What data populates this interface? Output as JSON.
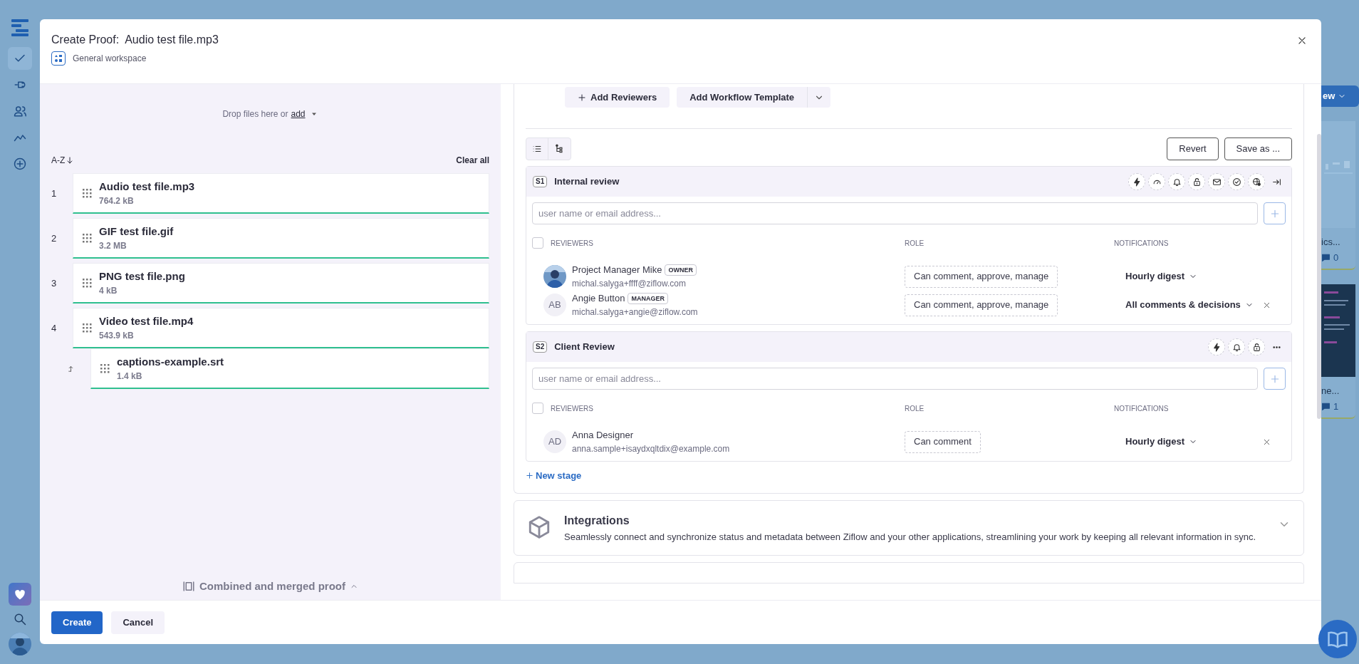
{
  "nav": {
    "items": [
      {
        "selected": true
      },
      {
        "selected": false
      },
      {
        "selected": false
      },
      {
        "selected": false
      },
      {
        "selected": false
      }
    ]
  },
  "background_app": {
    "button": "ew",
    "cards": [
      {
        "title": "ics...",
        "count": "0"
      },
      {
        "title": "ne...",
        "count": "1"
      }
    ]
  },
  "dialog": {
    "title": "Create Proof:  Audio test file.mp3",
    "workspace": "General workspace"
  },
  "upload": {
    "prompt": "Drop files here or",
    "link": "add"
  },
  "sort": {
    "label": "A-Z",
    "clear": "Clear all"
  },
  "files": [
    {
      "number": "1",
      "name": "Audio test file.mp3",
      "size": "764.2 kB"
    },
    {
      "number": "2",
      "name": "GIF test file.gif",
      "size": "3.2 MB"
    },
    {
      "number": "3",
      "name": "PNG test file.png",
      "size": "4 kB"
    },
    {
      "number": "4",
      "name": "Video test file.mp4",
      "size": "543.9 kB",
      "children": [
        {
          "name": "captions-example.srt",
          "size": "1.4 kB"
        }
      ]
    }
  ],
  "combine": {
    "label": "Combined and merged proof"
  },
  "workflow": {
    "add_reviewers": "Add Reviewers",
    "add_template": "Add Workflow Template",
    "revert": "Revert",
    "save_as": "Save as ...",
    "new_stage": "New stage",
    "stages": [
      {
        "badge": "S1",
        "title": "Internal review",
        "placeholder": "user name or email address...",
        "select_all": {
          "checked": false
        },
        "columns": [
          "REVIEWERS",
          "ROLE",
          "NOTIFICATIONS"
        ],
        "reviewers": [
          {
            "name": "Project Manager Mike",
            "tag": "OWNER",
            "email": "michal.salyga+ffff@ziflow.com",
            "role": "Can comment, approve, manage",
            "notifications": "Hourly digest",
            "removable": false
          },
          {
            "kind": "initials",
            "initials": "AB",
            "name": "Angie Button",
            "tag": "MANAGER",
            "email": "michal.salyga+angie@ziflow.com",
            "role": "Can comment, approve, manage",
            "notifications": "All comments & decisions",
            "removable": true
          }
        ]
      },
      {
        "badge": "S2",
        "title": "Client Review",
        "placeholder": "user name or email address...",
        "select_all": {
          "checked": false
        },
        "columns": [
          "REVIEWERS",
          "ROLE",
          "NOTIFICATIONS"
        ],
        "reviewers": [
          {
            "kind": "initials",
            "initials": "AD",
            "name": "Anna Designer",
            "email": "anna.sample+isaydxqltdix@example.com",
            "role": "Can comment",
            "notifications": "Hourly digest",
            "removable": true
          }
        ]
      }
    ]
  },
  "integrations": {
    "title": "Integrations",
    "description": "Seamlessly connect and synchronize status and metadata between Ziflow and your other applications, streamlining your work by keeping all relevant information in sync."
  },
  "footer": {
    "create": "Create",
    "cancel": "Cancel"
  }
}
